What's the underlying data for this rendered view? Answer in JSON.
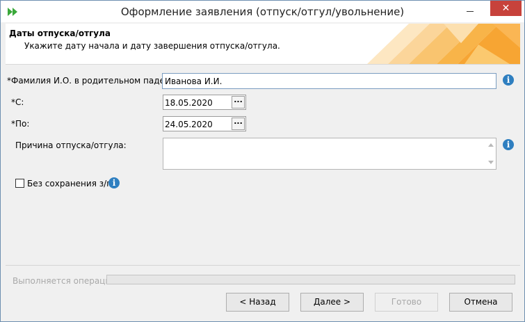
{
  "window": {
    "title": "Оформление заявления (отпуск/отгул/увольнение)",
    "close_glyph": "✕"
  },
  "header": {
    "title": "Даты отпуска/отгула",
    "subtitle": "Укажите дату начала и дату завершения отпуска/отгула."
  },
  "form": {
    "fio_label": "*Фамилия И.О. в родительном падеже:",
    "fio_value": "Иванова И.И.",
    "from_label": "*С:",
    "from_value": "18.05.2020",
    "to_label": "*По:",
    "to_value": "24.05.2020",
    "reason_label": "Причина отпуска/отгула:",
    "reason_value": "",
    "unpaid_label": "Без сохранения з/п",
    "unpaid_checked": false,
    "date_button_glyph": "...",
    "info_glyph": "i"
  },
  "status": {
    "label": "Выполняется операция",
    "progress": 0
  },
  "buttons": {
    "back": "< Назад",
    "next": "Далее >",
    "finish": "Готово",
    "cancel": "Отмена"
  },
  "colors": {
    "accent_orange": "#f7a533",
    "info_blue": "#2f7fc0",
    "close_red": "#c7423b"
  },
  "icons": [
    "forward-arrows-icon",
    "minimize-icon",
    "close-icon",
    "calendar-picker-icon",
    "info-icon",
    "checkbox-icon"
  ]
}
